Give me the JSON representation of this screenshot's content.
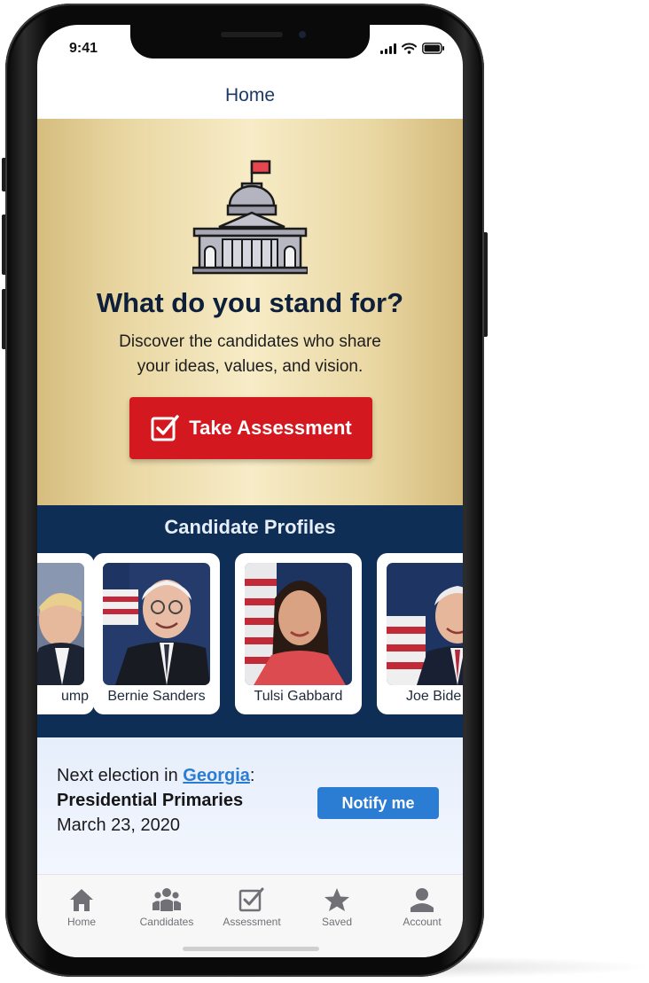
{
  "status_bar": {
    "time": "9:41"
  },
  "header": {
    "title": "Home"
  },
  "hero": {
    "title": "What do you stand for?",
    "subtitle_line1": "Discover the candidates who share",
    "subtitle_line2": "your ideas, values, and vision.",
    "button_label": "Take Assessment"
  },
  "candidates": {
    "section_title": "Candidate Profiles",
    "cards": [
      {
        "name": "Donald Trump",
        "visible_name": "ump"
      },
      {
        "name": "Bernie Sanders",
        "visible_name": "Bernie Sanders"
      },
      {
        "name": "Tulsi Gabbard",
        "visible_name": "Tulsi Gabbard"
      },
      {
        "name": "Joe Biden",
        "visible_name": "Joe Bide"
      }
    ]
  },
  "election": {
    "prefix": "Next election in ",
    "state": "Georgia",
    "suffix": ":",
    "type": "Presidential Primaries",
    "date": "March 23, 2020",
    "notify_label": "Notify me"
  },
  "tabbar": {
    "items": [
      {
        "label": "Home",
        "icon": "house-icon"
      },
      {
        "label": "Candidates",
        "icon": "people-icon"
      },
      {
        "label": "Assessment",
        "icon": "checkbox-icon"
      },
      {
        "label": "Saved",
        "icon": "star-icon"
      },
      {
        "label": "Account",
        "icon": "user-icon"
      }
    ]
  },
  "colors": {
    "accent_red": "#d3181f",
    "navy": "#0f2e56",
    "link_blue": "#2b7cd3",
    "gold": "#ead8a4"
  }
}
